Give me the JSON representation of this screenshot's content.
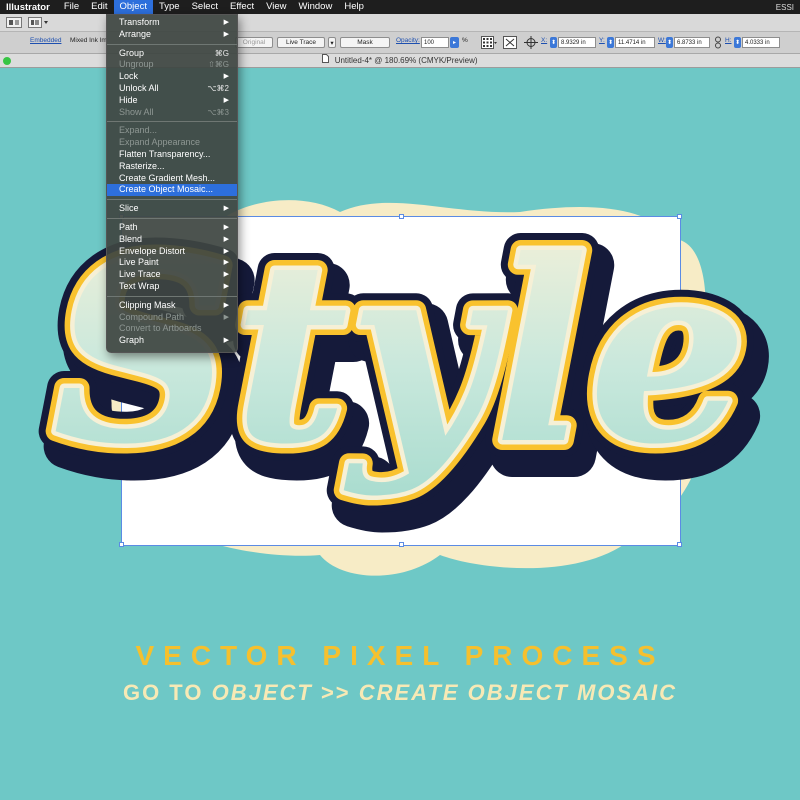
{
  "menubar": {
    "app": "Illustrator",
    "menus": [
      "File",
      "Edit",
      "Object",
      "Type",
      "Select",
      "Effect",
      "View",
      "Window",
      "Help"
    ],
    "active_menu": "Object",
    "right_label": "ESSI"
  },
  "toolbar": {
    "embedded_label": "Embedded",
    "mixed_label": "Mixed Ink Im",
    "original_label": "Original",
    "live_trace_label": "Live Trace",
    "mask_label": "Mask",
    "opacity_label": "Opacity:",
    "opacity_value": "100",
    "opacity_unit": "%",
    "x_label": "X:",
    "x_value": "8.9329 in",
    "y_label": "Y:",
    "y_value": "11.4714 in",
    "w_label": "W:",
    "w_value": "6.8733 in",
    "h_label": "H:",
    "h_value": "4.0333 in"
  },
  "document": {
    "title": "Untitled-4* @ 180.69% (CMYK/Preview)"
  },
  "object_menu": {
    "groups": [
      [
        {
          "label": "Transform",
          "submenu": true,
          "disabled": false
        },
        {
          "label": "Arrange",
          "submenu": true,
          "disabled": false
        }
      ],
      [
        {
          "label": "Group",
          "shortcut": "⌘G",
          "disabled": false
        },
        {
          "label": "Ungroup",
          "shortcut": "⇧⌘G",
          "disabled": true
        },
        {
          "label": "Lock",
          "submenu": true,
          "disabled": false
        },
        {
          "label": "Unlock All",
          "shortcut": "⌥⌘2",
          "disabled": false
        },
        {
          "label": "Hide",
          "submenu": true,
          "disabled": false
        },
        {
          "label": "Show All",
          "shortcut": "⌥⌘3",
          "disabled": true
        }
      ],
      [
        {
          "label": "Expand...",
          "disabled": true
        },
        {
          "label": "Expand Appearance",
          "disabled": true
        },
        {
          "label": "Flatten Transparency...",
          "disabled": false
        },
        {
          "label": "Rasterize...",
          "disabled": false
        },
        {
          "label": "Create Gradient Mesh...",
          "disabled": false
        },
        {
          "label": "Create Object Mosaic...",
          "disabled": false,
          "highlighted": true
        }
      ],
      [
        {
          "label": "Slice",
          "submenu": true,
          "disabled": false
        }
      ],
      [
        {
          "label": "Path",
          "submenu": true,
          "disabled": false
        },
        {
          "label": "Blend",
          "submenu": true,
          "disabled": false
        },
        {
          "label": "Envelope Distort",
          "submenu": true,
          "disabled": false
        },
        {
          "label": "Live Paint",
          "submenu": true,
          "disabled": false
        },
        {
          "label": "Live Trace",
          "submenu": true,
          "disabled": false
        },
        {
          "label": "Text Wrap",
          "submenu": true,
          "disabled": false
        }
      ],
      [
        {
          "label": "Clipping Mask",
          "submenu": true,
          "disabled": false
        },
        {
          "label": "Compound Path",
          "submenu": true,
          "disabled": true
        },
        {
          "label": "Convert to Artboards",
          "disabled": true
        },
        {
          "label": "Graph",
          "submenu": true,
          "disabled": false
        }
      ]
    ]
  },
  "artwork": {
    "word": "Style"
  },
  "captions": {
    "line1": "VECTOR PIXEL PROCESS",
    "line2_prefix": "GO TO ",
    "line2_object": "OBJECT",
    "line2_middle": " >> ",
    "line2_action": "CREATE OBJECT MOSAIC"
  },
  "colors": {
    "background": "#6ec8c6",
    "blob": "#f7ecc6",
    "outline_dark": "#151a3a",
    "outline_yellow": "#f9c22e",
    "highlight": "#2d6fdc",
    "caption_yellow": "#f5c02e",
    "caption_cream": "#f7e9b5"
  }
}
